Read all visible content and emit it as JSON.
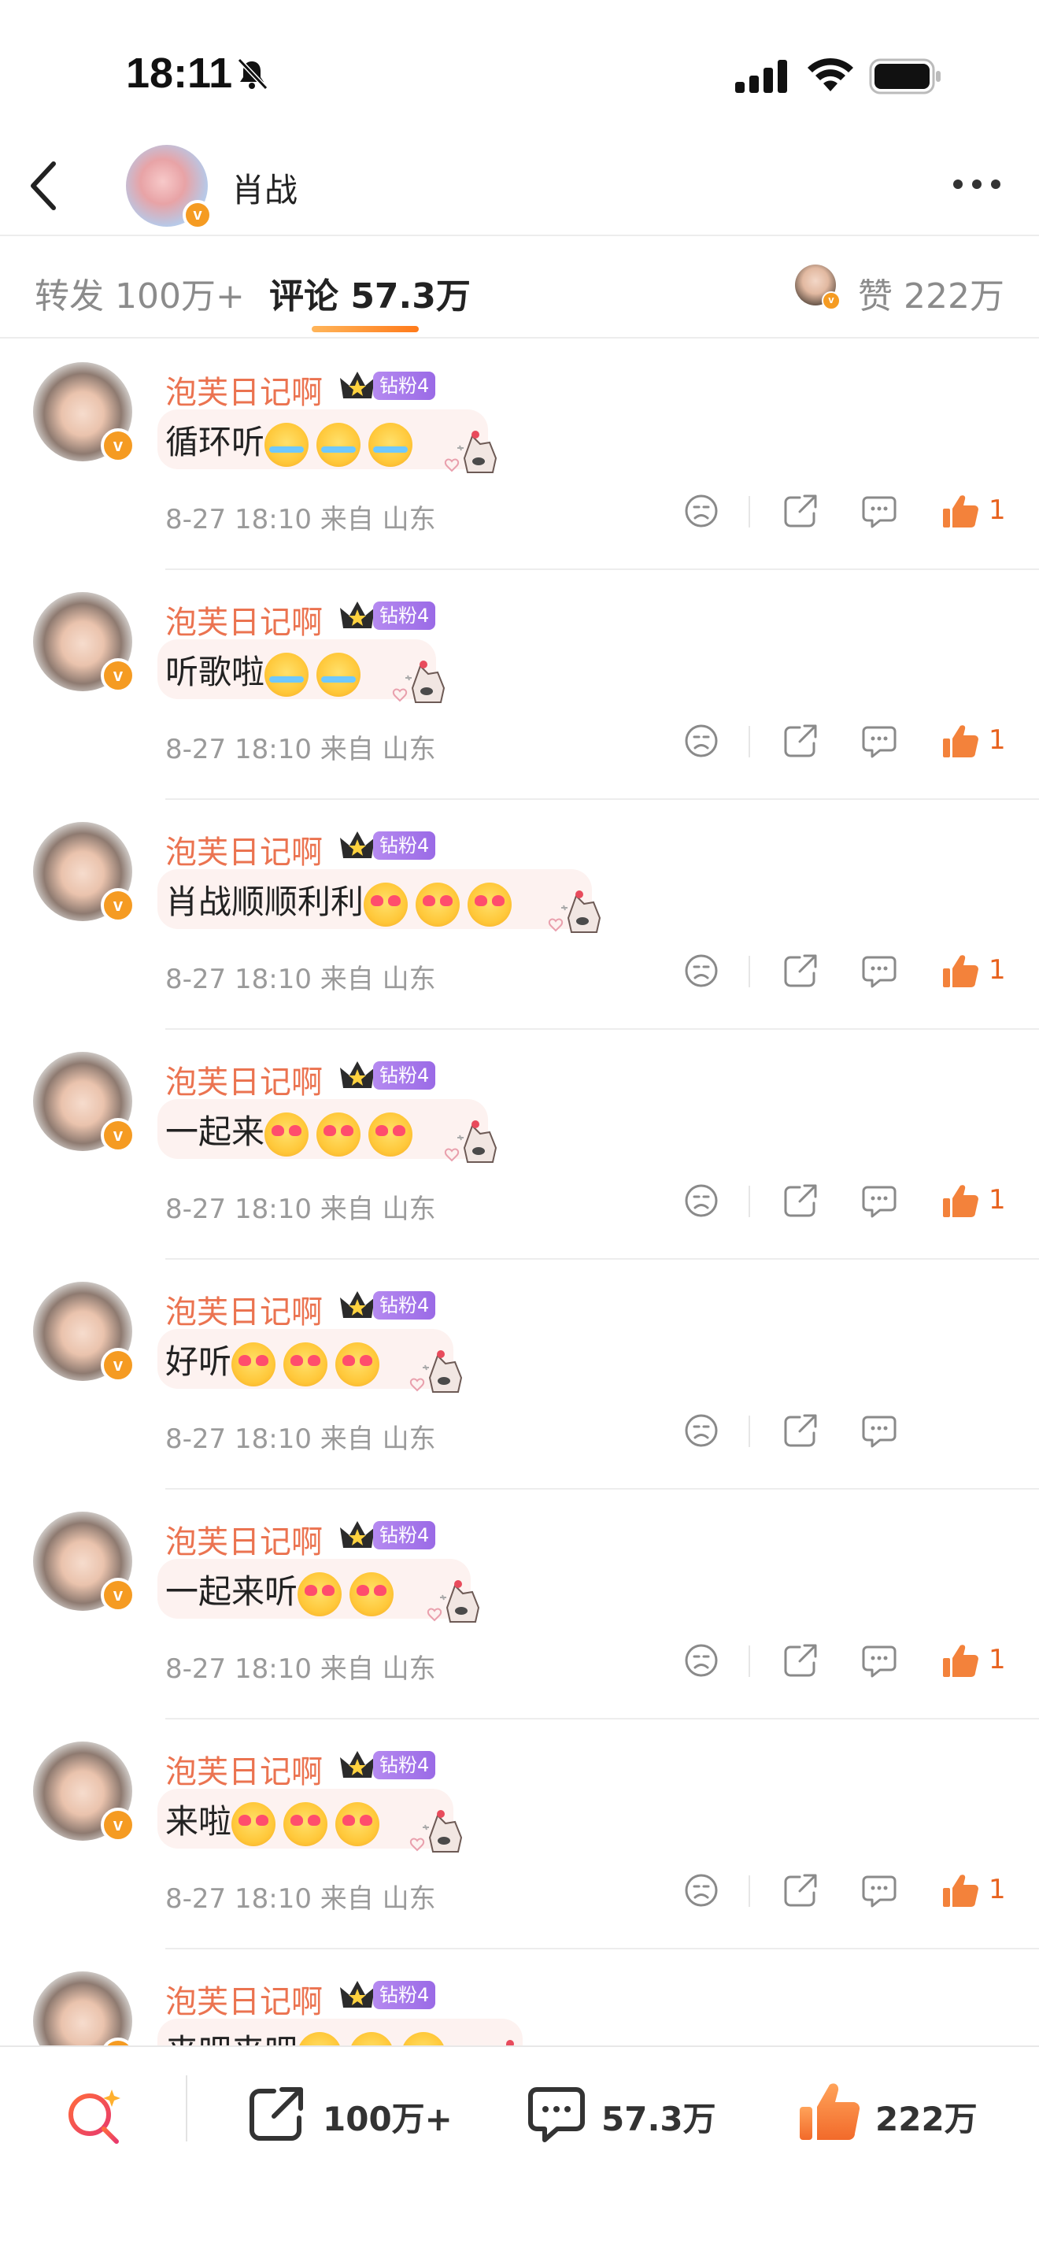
{
  "status_bar": {
    "time": "18:11"
  },
  "header": {
    "title": "肖战",
    "verified": "v"
  },
  "tabs": {
    "repost": "转发 100万+",
    "comments": "评论 57.3万",
    "likes": "赞 222万"
  },
  "comments": [
    {
      "name": "泡芙日记啊",
      "badge": "钻粉4",
      "text": "循环听",
      "emoji": [
        "cry",
        "cry",
        "cry"
      ],
      "time": "8-27 18:10 来自 山东",
      "likes": "1"
    },
    {
      "name": "泡芙日记啊",
      "badge": "钻粉4",
      "text": "听歌啦",
      "emoji": [
        "cry",
        "cry"
      ],
      "time": "8-27 18:10 来自 山东",
      "likes": "1"
    },
    {
      "name": "泡芙日记啊",
      "badge": "钻粉4",
      "text": "肖战顺顺利利",
      "emoji": [
        "heart",
        "heart",
        "heart"
      ],
      "time": "8-27 18:10 来自 山东",
      "likes": "1"
    },
    {
      "name": "泡芙日记啊",
      "badge": "钻粉4",
      "text": "一起来",
      "emoji": [
        "heart",
        "heart",
        "heart"
      ],
      "time": "8-27 18:10 来自 山东",
      "likes": "1"
    },
    {
      "name": "泡芙日记啊",
      "badge": "钻粉4",
      "text": "好听",
      "emoji": [
        "heart",
        "heart",
        "heart"
      ],
      "time": "8-27 18:10 来自 山东",
      "likes": ""
    },
    {
      "name": "泡芙日记啊",
      "badge": "钻粉4",
      "text": "一起来听",
      "emoji": [
        "heart",
        "heart"
      ],
      "time": "8-27 18:10 来自 山东",
      "likes": "1"
    },
    {
      "name": "泡芙日记啊",
      "badge": "钻粉4",
      "text": "来啦",
      "emoji": [
        "heart",
        "heart",
        "heart"
      ],
      "time": "8-27 18:10 来自 山东",
      "likes": "1"
    },
    {
      "name": "泡芙日记啊",
      "badge": "钻粉4",
      "text": "来吧来吧",
      "emoji": [
        "cry",
        "cry",
        "cry"
      ],
      "time": "",
      "likes": ""
    }
  ],
  "bottom_bar": {
    "repost": "100万+",
    "comment": "57.3万",
    "like": "222万"
  },
  "colors": {
    "accent_orange": "#eb7350",
    "like_orange": "#e8631f",
    "badge_purple": "#9a6ae6",
    "verified": "#f59b22"
  },
  "icons": [
    "bell-slash-icon",
    "signal-icon",
    "wifi-icon",
    "battery-icon",
    "back-icon",
    "more-icon",
    "crown-icon",
    "cake-sticker-icon",
    "dislike-face-icon",
    "share-icon",
    "comment-icon",
    "thumbs-up-icon",
    "search-sparkle-icon"
  ]
}
